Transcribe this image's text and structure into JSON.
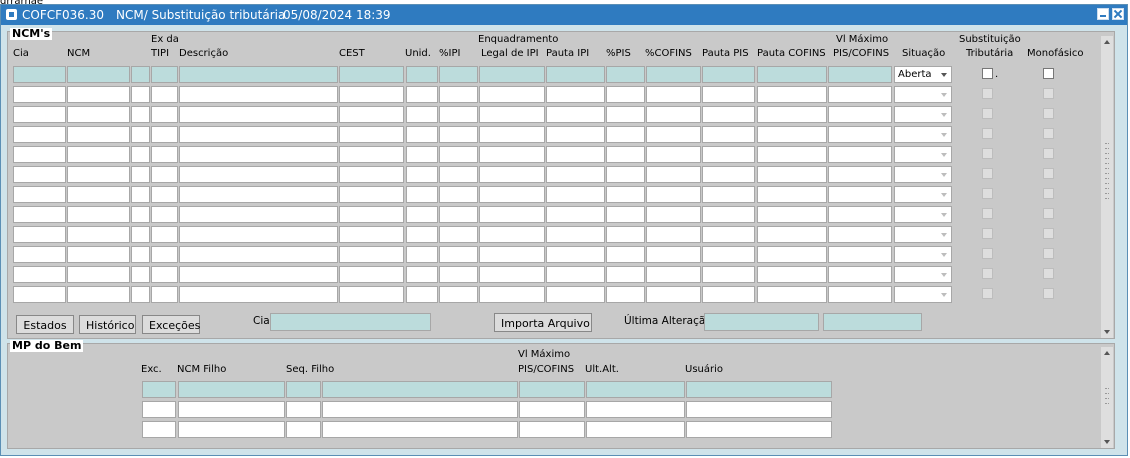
{
  "top_fragment": "drrarnae",
  "window": {
    "form_id": "COFCF036.30",
    "title": "NCM/ Substituição tributária",
    "datetime": "05/08/2024 18:39"
  },
  "ncm_section": {
    "label": "NCM's",
    "headers": {
      "cia": "Cia",
      "ncm": "NCM",
      "ex_tipi_line1": "Ex da",
      "ex_tipi_line2": "TIPI",
      "descricao": "Descrição",
      "cest": "CEST",
      "unid": "Unid.",
      "pct_ipi": "%IPI",
      "enquadramento_line1": "Enquadramento",
      "enquadramento_line2": "Legal de IPI",
      "pauta_ipi": "Pauta IPI",
      "pct_pis": "%PIS",
      "pct_cofins": "%COFINS",
      "pauta_pis": "Pauta PIS",
      "pauta_cofins": "Pauta COFINS",
      "vl_maximo_line1": "Vl Máximo",
      "vl_maximo_line2": "PIS/COFINS",
      "situacao": "Situação",
      "subst_line1": "Substituição",
      "subst_line2": "Tributária",
      "monofasico": "Monofásico"
    },
    "first_row_situacao": "Aberta",
    "first_row_trib_marker": ".",
    "buttons": {
      "estados": "Estados",
      "historico": "Histórico",
      "excecoes": "Exceções",
      "importa": "Importa Arquivo"
    },
    "cia_label": "Cia",
    "ultima_alteracao_label": "Última Alteração"
  },
  "mp_section": {
    "label": "MP do Bem",
    "headers": {
      "exc": "Exc.",
      "ncm_filho": "NCM Filho",
      "seq_filho": "Seq. Filho",
      "vl_maximo_line1": "Vl Máximo",
      "vl_maximo_line2": "PIS/COFINS",
      "ult_alt": "Ult.Alt.",
      "usuario": "Usuário"
    }
  },
  "colors": {
    "titlebar": "#2f7bc0",
    "window_border": "#cfe3ea",
    "panel": "#c9c9c9",
    "current_row": "#bcdcdc"
  }
}
